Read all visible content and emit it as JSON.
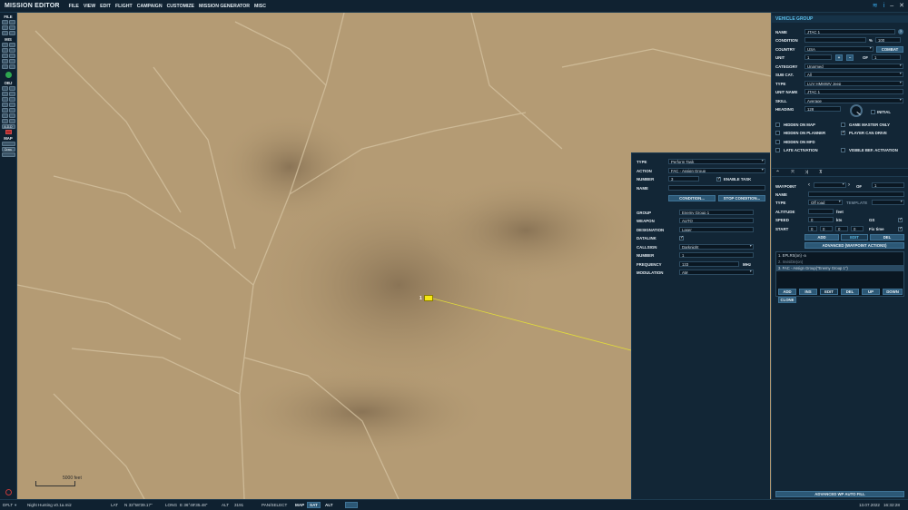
{
  "app": {
    "title": "MISSION EDITOR"
  },
  "menu": [
    "FILE",
    "VIEW",
    "EDIT",
    "FLIGHT",
    "CAMPAIGN",
    "CUSTOMIZE",
    "MISSION GENERATOR",
    "MISC"
  ],
  "left_toolbar": {
    "file_label": "FILE",
    "mis_label": "MIS",
    "obj_label": "OBJ",
    "map_label": "MAP",
    "add_label": "A-D-D",
    "draw_label": "Draw"
  },
  "map": {
    "scale_label": "5000 feet",
    "unit_number": "1"
  },
  "task_panel": {
    "type_label": "TYPE",
    "type_value": "Perform Task",
    "action_label": "ACTION",
    "action_value": "FAC - Assign Group",
    "number_label": "NUMBER",
    "number_value": "3",
    "enable_task_label": "ENABLE TASK",
    "name_label": "NAME",
    "name_value": "",
    "condition_btn": "CONDITION...",
    "stop_condition_btn": "STOP CONDITION...",
    "group_label": "GROUP",
    "group_value": "Enemy Group 1",
    "weapon_label": "WEAPON",
    "weapon_value": "AUTO",
    "designation_label": "DESIGNATION",
    "designation_value": "Laser",
    "datalink_label": "DATALINK",
    "callsign_label": "CALLSIGN",
    "callsign_value": "Darknight",
    "number2_label": "NUMBER",
    "number2_value": "1",
    "frequency_label": "FREQUENCY",
    "frequency_value": "133",
    "frequency_unit": "MHz",
    "modulation_label": "MODULATION",
    "modulation_value": "AM"
  },
  "vehicle_group": {
    "header": "VEHICLE GROUP",
    "name_label": "NAME",
    "name_value": "JTAC 1",
    "condition_label": "CONDITION",
    "condition_pct": "%",
    "condition_value": "100",
    "country_label": "COUNTRY",
    "country_value": "USA",
    "combat_btn": "COMBAT",
    "unit_label": "UNIT",
    "unit_value": "1",
    "unit_of": "OF",
    "unit_of_value": "1",
    "category_label": "CATEGORY",
    "category_value": "Unarmed",
    "subcat_label": "SUB CAT.",
    "subcat_value": "All",
    "type_label": "TYPE",
    "type_value": "LUV HMMWV Jeep",
    "unitname_label": "UNIT NAME",
    "unitname_value": "JTAC 1",
    "skill_label": "SKILL",
    "skill_value": "Average",
    "heading_label": "HEADING",
    "heading_value": "128",
    "initial_label": "INITIAL",
    "checks": [
      {
        "label": "HIDDEN ON MAP",
        "on": false
      },
      {
        "label": "GAME MASTER ONLY",
        "on": false
      },
      {
        "label": "HIDDEN ON PLANNER",
        "on": false
      },
      {
        "label": "PLAYER CAN DRIVE",
        "on": true
      },
      {
        "label": "HIDDEN ON MFD",
        "on": false
      },
      {
        "label": "LATE ACTIVATION",
        "on": false
      },
      {
        "label": "VISIBLE BEF. ACTIVATION",
        "on": false
      }
    ]
  },
  "waypoint": {
    "waypoint_label": "WAYPOINT",
    "of_label": "OF",
    "of_value": "1",
    "name_label": "NAME",
    "type_label": "TYPE",
    "type_value": "Off road",
    "template_label": "TEMPLATE",
    "altitude_label": "ALTITUDE",
    "altitude_unit": "feet",
    "speed_label": "SPEED",
    "speed_value": "0",
    "speed_unit": "kts",
    "gs_label": "GS",
    "start_label": "START",
    "start_h": "0",
    "start_m": "0",
    "start_s": "0",
    "start_d": "0",
    "fix_time_label": "Fix time",
    "add_btn": "ADD",
    "edit_btn": "EDIT",
    "del_btn": "DEL",
    "adv_btn": "ADVANCED (WAYPOINT ACTIONS)",
    "actions": [
      "1. EPLRS(on) -a",
      "2. Invisible(on)",
      "3. FAC - Assign Group(\"Enemy Group 1\")"
    ],
    "act_add": "ADD",
    "act_ins": "INS",
    "act_edit": "EDIT",
    "act_del": "DEL",
    "act_up": "UP",
    "act_down": "DOWN",
    "act_clone": "CLONE",
    "autofill_btn": "ADVANCED WP AUTO FILL"
  },
  "statusbar": {
    "mode": "DFLT",
    "file": "Night Hunting v0.1a.miz",
    "lat_label": "LAT",
    "lat_value": "N 33°58'39.17\"",
    "long_label": "LONG",
    "long_value": "E 36°49'35.48\"",
    "alt_label": "ALT",
    "alt_value": "3191",
    "pan_label": "PAN/SELECT",
    "map_btn": "MAP",
    "sat_btn": "SAT",
    "alt_btn": "ALT",
    "date": "13.07.2022",
    "time": "16:32:28"
  },
  "colors": {
    "accent": "#5bbde8",
    "marker": "#f6e714",
    "route": "#e3dd3a"
  }
}
